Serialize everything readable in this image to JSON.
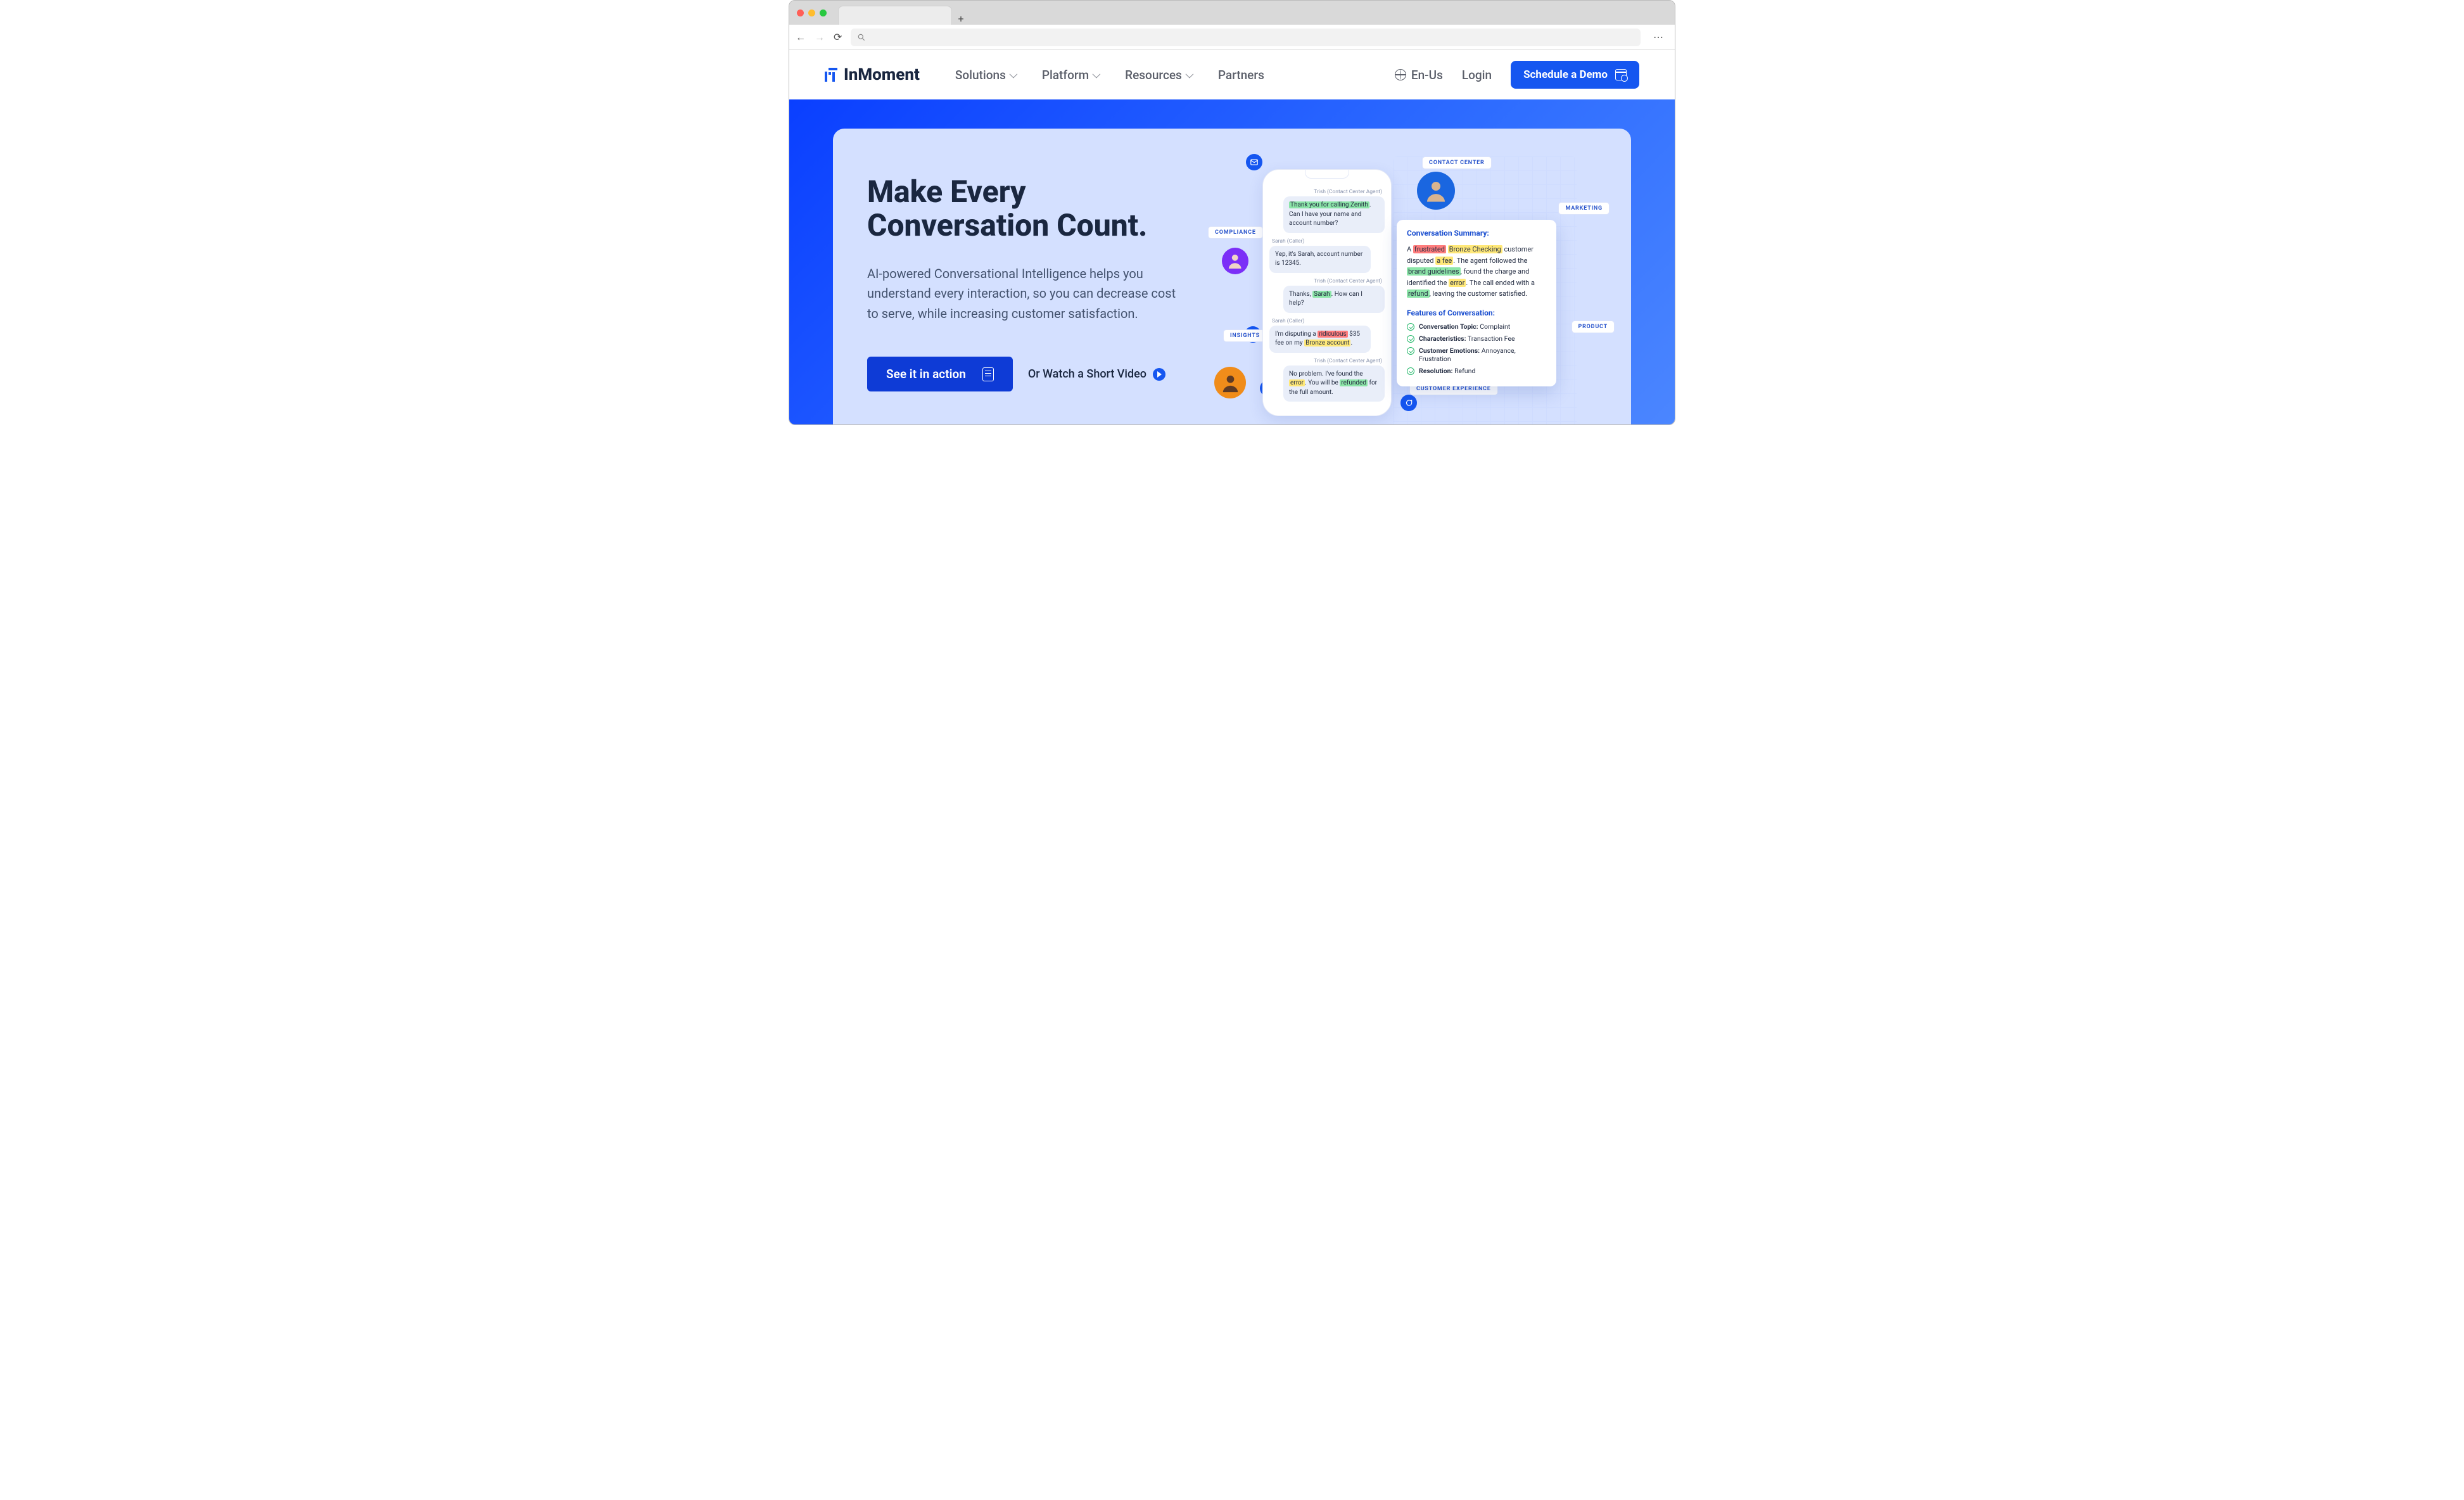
{
  "header": {
    "brand": "InMoment",
    "nav": {
      "solutions": "Solutions",
      "platform": "Platform",
      "resources": "Resources",
      "partners": "Partners"
    },
    "lang": "En-Us",
    "login": "Login",
    "demo_cta": "Schedule a Demo"
  },
  "hero": {
    "headline_l1": "Make Every",
    "headline_l2": "Conversation Count.",
    "subhead": "AI-powered Conversational Intelligence helps you understand every interaction, so you can decrease cost to serve, while increasing customer satisfaction.",
    "primary_cta": "See it in action",
    "video_link": "Or Watch a Short Video"
  },
  "pills": {
    "compliance": "COMPLIANCE",
    "insights": "INSIGHTS",
    "contact_center": "CONTACT CENTER",
    "marketing": "MARKETING",
    "product": "PRODUCT",
    "cx": "CUSTOMER EXPERIENCE"
  },
  "chat": {
    "agent_name": "Trish (Contact Center Agent)",
    "caller_name": "Sarah (Caller)",
    "m1_pre": "Thank you for calling Zenith",
    "m1_rest": ". Can I have your name and account number?",
    "m2": "Yep, it's Sarah, account number is 12345.",
    "m3_a": "Thanks, ",
    "m3_hl": "Sarah",
    "m3_b": ". How can I help?",
    "m4_a": "I'm disputing a ",
    "m4_hl1": "ridiculous",
    "m4_b": " $35 fee on my ",
    "m4_hl2": "Bronze account",
    "m4_c": ".",
    "m5_a": "No problem. I've found the ",
    "m5_hl1": "error",
    "m5_b": ". You will be ",
    "m5_hl2": "refunded",
    "m5_c": " for the full amount."
  },
  "summary": {
    "title": "Conversation Summary:",
    "s_a": "A ",
    "s_hl1": "frustrated",
    "s_b": " ",
    "s_hl2": "Bronze Checking",
    "s_c": " customer disputed ",
    "s_hl3": "a fee",
    "s_d": ". The agent followed the ",
    "s_hl4": "brand guidelines",
    "s_e": ", found the charge and identified the ",
    "s_hl5": "error",
    "s_f": ". The call ended with a ",
    "s_hl6": "refund",
    "s_g": ", leaving the customer satisfied.",
    "features_title": "Features of Conversation:",
    "f1_label": "Conversation Topic:",
    "f1_value": " Complaint",
    "f2_label": "Characteristics:",
    "f2_value": " Transaction Fee",
    "f3_label": "Customer Emotions:",
    "f3_value": " Annoyance, Frustration",
    "f4_label": "Resolution:",
    "f4_value": " Refund"
  }
}
